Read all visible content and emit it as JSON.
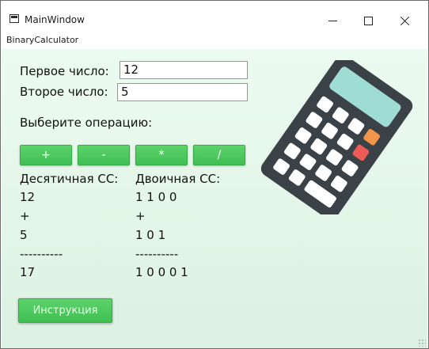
{
  "window": {
    "title": "MainWindow",
    "subtitle": "BinaryCalculator"
  },
  "form": {
    "first_label": "Первое число:",
    "first_value": "12",
    "second_label": "Второе число:",
    "second_value": "5",
    "operation_label": "Выберите операцию:"
  },
  "operations": [
    "+",
    "-",
    "*",
    "/"
  ],
  "results": {
    "decimal_header": "Десятичная СС:",
    "binary_header": "Двоичная СС:",
    "decimal_lines": [
      "12",
      "+",
      "5",
      "----------",
      "17"
    ],
    "binary_lines": [
      "1 1 0 0",
      "+",
      "1 0 1",
      "----------",
      "1 0 0 0 1"
    ]
  },
  "help_button": "Инструкция",
  "icons": {
    "app": "window-icon",
    "minimize": "minimize-icon",
    "maximize": "maximize-icon",
    "close": "close-icon",
    "calculator": "calculator-icon"
  },
  "colors": {
    "accent_green": "#4cc95d",
    "background_tint": "#e3f6e8",
    "calculator_body": "#3a4247",
    "calculator_screen": "#9fdcd6",
    "calculator_orange": "#f2954b",
    "calculator_red": "#ec5b56"
  }
}
